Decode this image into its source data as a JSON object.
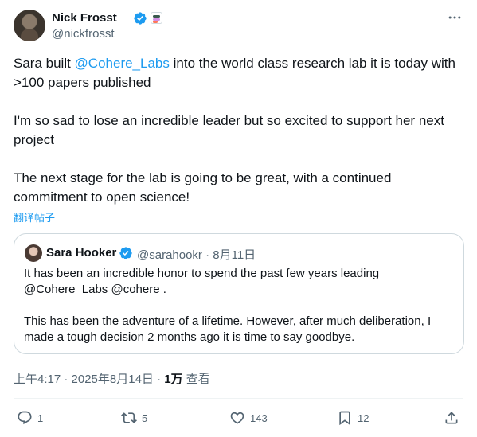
{
  "author": {
    "name": "Nick Frosst",
    "handle": "@nickfrosst"
  },
  "post": {
    "text_before_mention": "Sara built ",
    "mention": "@Cohere_Labs",
    "text_after_mention": " into the world class research lab it is today with >100 papers published",
    "paragraph2": "I'm so sad to lose an incredible leader but so excited to support her next project",
    "paragraph3": "The next stage for the lab is going to be great, with a continued commitment to open science!"
  },
  "translate_label": "翻译帖子",
  "quote": {
    "name": "Sara Hooker",
    "meta": "@sarahookr · 8月11日",
    "paragraph1": "It has been an incredible honor to spend the past few years leading @Cohere_Labs @cohere .",
    "paragraph2": "This has been the adventure of a lifetime. However, after much deliberation, I made a tough decision 2 months ago it is time to say goodbye."
  },
  "timestamp": {
    "time": "上午4:17 · 2025年8月14日 · ",
    "views": "1万",
    "views_label": " 查看"
  },
  "actions": {
    "replies": "1",
    "reposts": "5",
    "likes": "143",
    "bookmarks": "12"
  },
  "colors": {
    "accent": "#1d9bf0",
    "secondary_text": "#536471",
    "border": "#cfd9de"
  }
}
